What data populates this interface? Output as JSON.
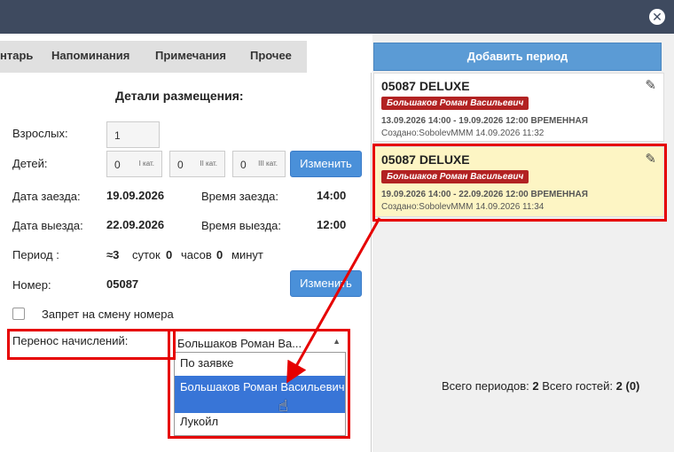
{
  "titlebar": {
    "close_icon": "close-icon"
  },
  "tabs": [
    {
      "label": "нтарь"
    },
    {
      "label": "Напоминания"
    },
    {
      "label": "Примечания"
    },
    {
      "label": "Прочее"
    }
  ],
  "details": {
    "title": "Детали размещения:",
    "adults_label": "Взрослых:",
    "adults_value": "1",
    "children_label": "Детей:",
    "children": [
      {
        "value": "0",
        "cat": "I кат."
      },
      {
        "value": "0",
        "cat": "II кат."
      },
      {
        "value": "0",
        "cat": "III кат."
      }
    ],
    "change_button": "Изменить",
    "checkin_date_label": "Дата заезда:",
    "checkin_date": "19.09.2026",
    "checkin_time_label": "Время заезда:",
    "checkin_time": "14:00",
    "checkout_date_label": "Дата выезда:",
    "checkout_date": "22.09.2026",
    "checkout_time_label": "Время выезда:",
    "checkout_time": "12:00",
    "period_label": "Период :",
    "period_approx": "≈3",
    "days_label": "суток",
    "days": "0",
    "hours_label": "часов",
    "hours": "0",
    "minutes_label": "минут",
    "room_label": "Номер:",
    "room": "05087",
    "room_change_button": "Изменить",
    "no_room_change_label": "Запрет на смену номера",
    "transfer_label": "Перенос начислений:",
    "transfer_selected": "Большаков Роман Ва...",
    "transfer_options": [
      {
        "label": "По заявке"
      },
      {
        "label": "Большаков Роман Васильевич"
      },
      {
        "label": "Лукойл"
      }
    ]
  },
  "right": {
    "add_period_button": "Добавить период",
    "periods": [
      {
        "room_type": "05087 DELUXE",
        "guest": "Большаков Роман Васильевич",
        "dates": "13.09.2026 14:00 - 19.09.2026 12:00 ВРЕМЕННАЯ",
        "created": "Создано:SobolevMMM 14.09.2026 11:32"
      },
      {
        "room_type": "05087 DELUXE",
        "guest": "Большаков Роман Васильевич",
        "dates": "19.09.2026 14:00 - 22.09.2026 12:00 ВРЕМЕННАЯ",
        "created": "Создано:SobolevMMM 14.09.2026 11:34"
      }
    ],
    "totals_periods_label": "Всего периодов:",
    "totals_periods": "2",
    "totals_guests_label": "Всего гостей:",
    "totals_guests": "2 (0)"
  },
  "colors": {
    "titlebar": "#3e4a5f",
    "accent_button": "#4a90d9",
    "guest_badge": "#b22222",
    "active_card": "#fdf5c4",
    "highlight": "#e60000",
    "selected_option": "#3875d7"
  }
}
